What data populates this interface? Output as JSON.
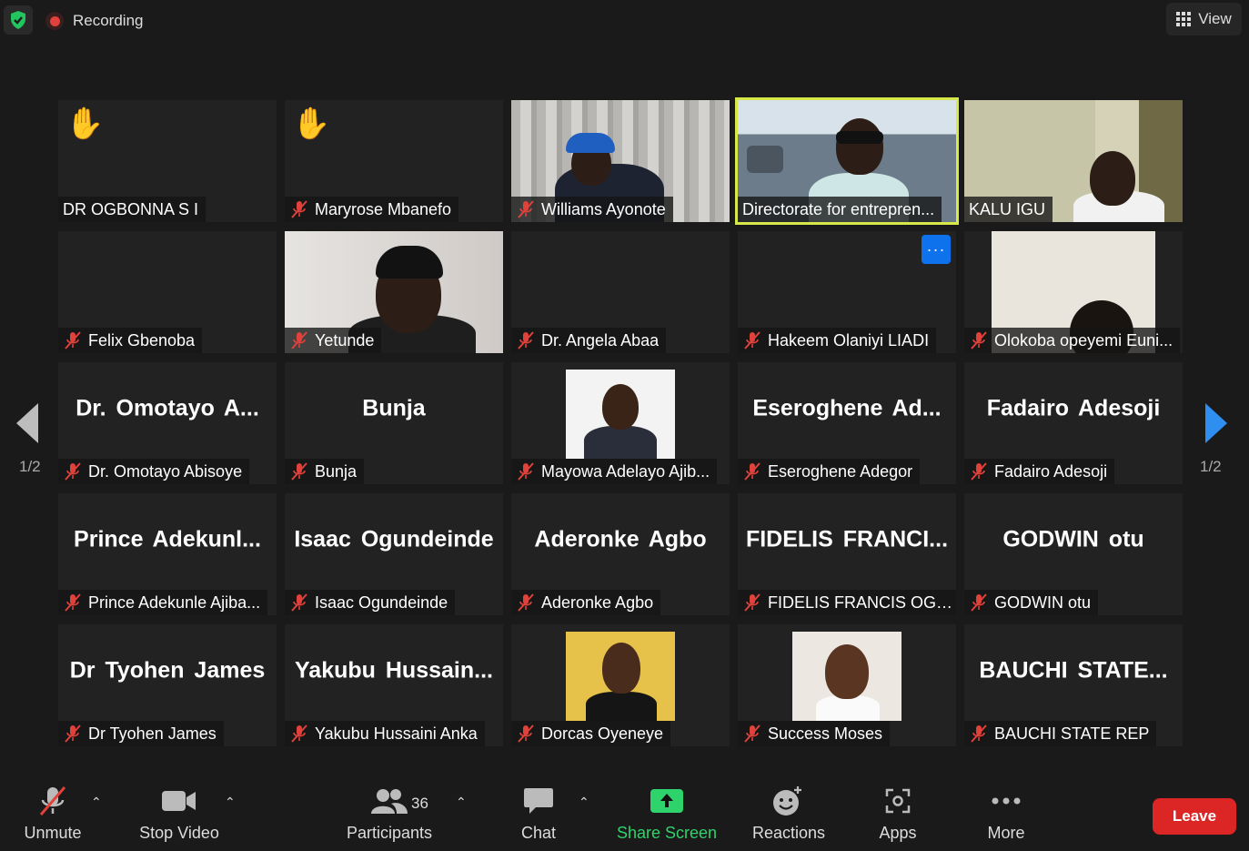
{
  "topbar": {
    "recording": "Recording",
    "view": "View"
  },
  "nav": {
    "page_left": "1/2",
    "page_right": "1/2"
  },
  "tiles": [
    {
      "name": "DR OGBONNA S I",
      "hand": true,
      "muted": false
    },
    {
      "name": "Maryrose Mbanefo",
      "hand": true,
      "muted": true
    },
    {
      "name": "Williams Ayonote",
      "muted": true,
      "video": "blinds"
    },
    {
      "name": "Directorate for entrepren...",
      "muted": false,
      "video": "water",
      "active": true
    },
    {
      "name": "KALU IGU",
      "muted": false,
      "video": "room"
    },
    {
      "name": "Felix Gbenoba",
      "muted": true
    },
    {
      "name": "Yetunde",
      "muted": true,
      "video": "wall"
    },
    {
      "name": "Dr. Angela Abaa",
      "muted": true
    },
    {
      "name": "Hakeem Olaniyi LIADI",
      "muted": true,
      "more": "···"
    },
    {
      "name": "Olokoba opeyemi Euni...",
      "muted": true,
      "video": "wall2"
    },
    {
      "name": "Dr. Omotayo Abisoye",
      "big": "Dr. Omotayo A...",
      "muted": true
    },
    {
      "name": "Bunja",
      "big": "Bunja",
      "muted": true
    },
    {
      "name": "Mayowa Adelayo Ajib...",
      "muted": true,
      "avatar": "man"
    },
    {
      "name": "Eseroghene Adegor",
      "big": "Eseroghene Ad...",
      "muted": true
    },
    {
      "name": "Fadairo Adesoji",
      "big": "Fadairo Adesoji",
      "muted": true
    },
    {
      "name": "Prince Adekunle Ajiba...",
      "big": "Prince Adekunl...",
      "muted": true
    },
    {
      "name": "Isaac Ogundeinde",
      "big": "Isaac Ogundeinde",
      "muted": true
    },
    {
      "name": "Aderonke Agbo",
      "big": "Aderonke Agbo",
      "muted": true
    },
    {
      "name": "FIDELIS FRANCIS OGU...",
      "big": "FIDELIS FRANCI...",
      "muted": true
    },
    {
      "name": "GODWIN otu",
      "big": "GODWIN otu",
      "muted": true
    },
    {
      "name": "Dr Tyohen James",
      "big": "Dr Tyohen James",
      "muted": true
    },
    {
      "name": "Yakubu Hussaini Anka",
      "big": "Yakubu Hussain...",
      "muted": true
    },
    {
      "name": "Dorcas Oyeneye",
      "muted": true,
      "avatar": "woman1"
    },
    {
      "name": "Success Moses",
      "muted": true,
      "avatar": "woman2"
    },
    {
      "name": "BAUCHI STATE REP",
      "big": "BAUCHI STATE...",
      "muted": true
    }
  ],
  "toolbar": {
    "unmute": "Unmute",
    "stop_video": "Stop Video",
    "participants": "Participants",
    "participants_count": "36",
    "chat": "Chat",
    "share_screen": "Share Screen",
    "reactions": "Reactions",
    "apps": "Apps",
    "more": "More",
    "leave": "Leave"
  },
  "colors": {
    "accent_green": "#2ed36b",
    "active_border": "#d7e84a",
    "leave": "#dc2626",
    "mute_red": "#e0413b",
    "blue": "#0e72ed"
  }
}
